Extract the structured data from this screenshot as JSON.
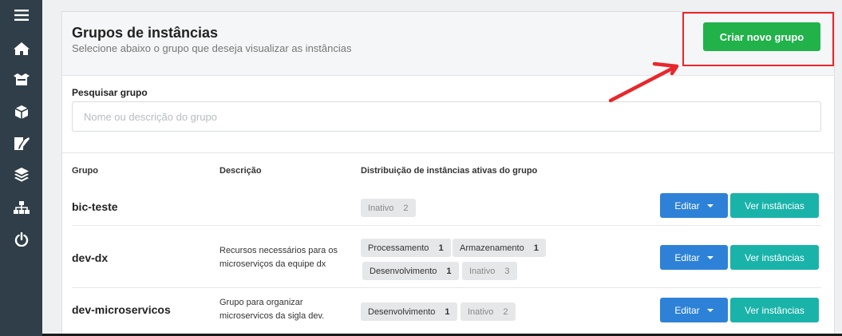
{
  "sidebar": {
    "items": [
      {
        "icon": "menu-icon"
      },
      {
        "icon": "home-icon"
      },
      {
        "icon": "package-open-icon"
      },
      {
        "icon": "cube-icon"
      },
      {
        "icon": "edit-document-icon"
      },
      {
        "icon": "layers-icon"
      },
      {
        "icon": "sitemap-icon"
      },
      {
        "icon": "power-icon"
      }
    ]
  },
  "header": {
    "title": "Grupos de instâncias",
    "subtitle": "Selecione abaixo o grupo que deseja visualizar as instâncias",
    "create_button": "Criar novo grupo"
  },
  "search": {
    "label": "Pesquisar grupo",
    "placeholder": "Nome ou descrição do grupo",
    "value": ""
  },
  "table": {
    "headers": {
      "group": "Grupo",
      "description": "Descrição",
      "distribution": "Distribuição de instâncias ativas do grupo"
    },
    "rows": [
      {
        "name": "bic-teste",
        "description": "",
        "tags": [
          {
            "label": "Inativo",
            "count": "2",
            "inactive": true
          }
        ],
        "edit_label": "Editar",
        "view_label": "Ver instâncias"
      },
      {
        "name": "dev-dx",
        "description": "Recursos necessários para os microserviços da equipe dx",
        "tags": [
          {
            "label": "Processamento",
            "count": "1",
            "inactive": false
          },
          {
            "label": "Armazenamento",
            "count": "1",
            "inactive": false
          },
          {
            "label": "Desenvolvimento",
            "count": "1",
            "inactive": false
          },
          {
            "label": "Inativo",
            "count": "3",
            "inactive": true
          }
        ],
        "edit_label": "Editar",
        "view_label": "Ver instâncias"
      },
      {
        "name": "dev-microservicos",
        "description": "Grupo para organizar microservicos da sigla dev.",
        "tags": [
          {
            "label": "Desenvolvimento",
            "count": "1",
            "inactive": false
          },
          {
            "label": "Inativo",
            "count": "2",
            "inactive": true
          }
        ],
        "edit_label": "Editar",
        "view_label": "Ver instâncias"
      }
    ]
  },
  "colors": {
    "sidebar_bg": "#2f3e48",
    "create_button": "#21b24a",
    "edit_button": "#2d82d7",
    "view_button": "#1ab3aa",
    "annotation_red": "#e8272c"
  }
}
